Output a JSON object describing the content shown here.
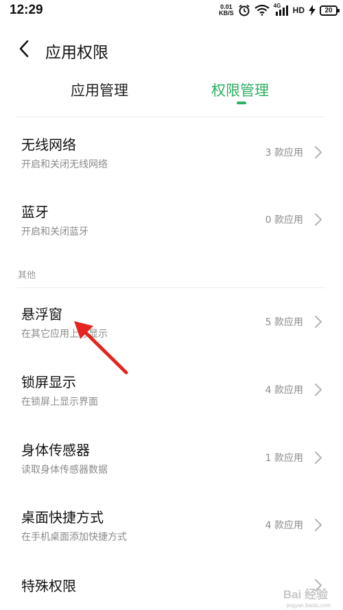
{
  "status_bar": {
    "time": "12:29",
    "net_speed_value": "0.01",
    "net_speed_unit": "KB/S",
    "network_type": "4G",
    "hd_label": "HD",
    "battery_level": "20"
  },
  "header": {
    "title": "应用权限"
  },
  "tabs": [
    {
      "label": "应用管理",
      "active": false
    },
    {
      "label": "权限管理",
      "active": true
    }
  ],
  "accent_color": "#2bb061",
  "items_top": [
    {
      "title": "无线网络",
      "subtitle": "开启和关闭无线网络",
      "count": "3 款应用"
    },
    {
      "title": "蓝牙",
      "subtitle": "开启和关闭蓝牙",
      "count": "0 款应用"
    }
  ],
  "section_other": {
    "label": "其他"
  },
  "items_other": [
    {
      "title": "悬浮窗",
      "subtitle": "在其它应用上方显示",
      "count": "5 款应用"
    },
    {
      "title": "锁屏显示",
      "subtitle": "在锁屏上显示界面",
      "count": "4 款应用"
    },
    {
      "title": "身体传感器",
      "subtitle": "读取身体传感器数据",
      "count": "1 款应用"
    },
    {
      "title": "桌面快捷方式",
      "subtitle": "在手机桌面添加快捷方式",
      "count": "4 款应用"
    },
    {
      "title": "特殊权限"
    }
  ],
  "icons": {
    "back": "back-arrow-icon",
    "chevron": "chevron-right-icon",
    "alarm": "alarm-clock-icon",
    "wifi": "wifi-icon",
    "signal": "signal-icon",
    "charging": "charging-bolt-icon",
    "annotation": "red-arrow-icon"
  },
  "watermark": {
    "text": "Bai 经验",
    "sub": "jingyan.baidu.com"
  }
}
